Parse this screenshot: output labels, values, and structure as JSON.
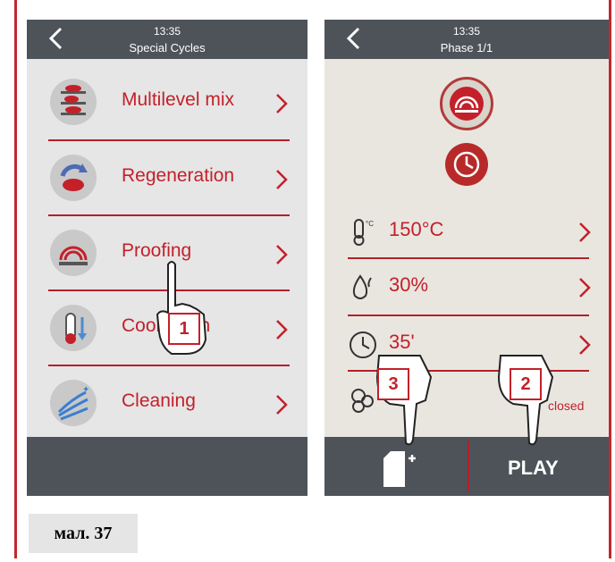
{
  "colors": {
    "accent": "#c4202a",
    "bar": "#4e5359",
    "screen_bg": "#e6e6e6"
  },
  "left_screen": {
    "time": "13:35",
    "title": "Special Cycles",
    "items": [
      {
        "label": "Multilevel mix",
        "icon": "multilevel-mix-icon"
      },
      {
        "label": "Regeneration",
        "icon": "regeneration-icon"
      },
      {
        "label": "Proofing",
        "icon": "proofing-icon"
      },
      {
        "label": "Cool down",
        "icon": "cool-down-icon"
      },
      {
        "label": "Cleaning",
        "icon": "cleaning-icon"
      }
    ]
  },
  "right_screen": {
    "time": "13:35",
    "title": "Phase 1/1",
    "temperature": "150°C",
    "humidity": "30%",
    "time_value": "35'",
    "vent_status": "closed",
    "play_label": "PLAY"
  },
  "callouts": [
    "1",
    "3",
    "2"
  ],
  "caption": "мал. 37"
}
